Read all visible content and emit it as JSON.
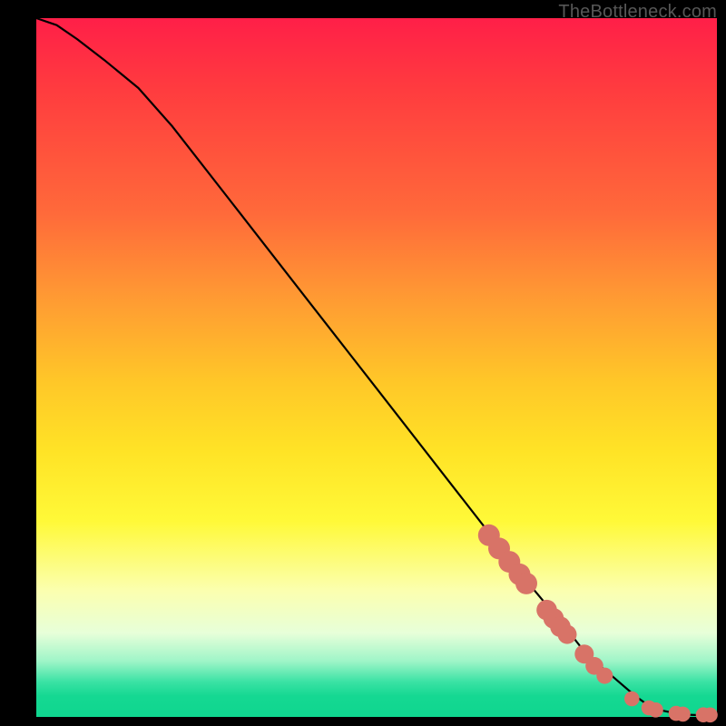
{
  "attribution": "TheBottleneck.com",
  "chart_data": {
    "type": "line",
    "title": "",
    "xlabel": "",
    "ylabel": "",
    "xlim": [
      0,
      100
    ],
    "ylim": [
      0,
      100
    ],
    "series": [
      {
        "name": "curve",
        "x": [
          0,
          3,
          6,
          10,
          15,
          20,
          30,
          40,
          50,
          60,
          68,
          72,
          75,
          78,
          80,
          82,
          85,
          88,
          90,
          92,
          94,
          96,
          98,
          100
        ],
        "y": [
          100,
          99,
          97,
          94,
          90,
          84.5,
          72,
          59.5,
          47,
          34.5,
          24.5,
          19.5,
          16,
          12.5,
          10,
          8,
          5.5,
          3,
          1.6,
          0.9,
          0.5,
          0.3,
          0.25,
          0.25
        ]
      }
    ],
    "markers": [
      {
        "x": 66.5,
        "y": 26.0,
        "r": 1.6
      },
      {
        "x": 68.0,
        "y": 24.1,
        "r": 1.6
      },
      {
        "x": 69.5,
        "y": 22.2,
        "r": 1.6
      },
      {
        "x": 71.0,
        "y": 20.4,
        "r": 1.6
      },
      {
        "x": 72.0,
        "y": 19.1,
        "r": 1.6
      },
      {
        "x": 75.0,
        "y": 15.3,
        "r": 1.5
      },
      {
        "x": 76.0,
        "y": 14.1,
        "r": 1.5
      },
      {
        "x": 77.0,
        "y": 12.9,
        "r": 1.5
      },
      {
        "x": 78.0,
        "y": 11.8,
        "r": 1.4
      },
      {
        "x": 80.5,
        "y": 9.0,
        "r": 1.4
      },
      {
        "x": 82.0,
        "y": 7.3,
        "r": 1.3
      },
      {
        "x": 83.5,
        "y": 5.9,
        "r": 1.2
      },
      {
        "x": 87.5,
        "y": 2.6,
        "r": 1.1
      },
      {
        "x": 90.0,
        "y": 1.3,
        "r": 1.1
      },
      {
        "x": 91.0,
        "y": 1.0,
        "r": 1.1
      },
      {
        "x": 94.0,
        "y": 0.5,
        "r": 1.1
      },
      {
        "x": 95.0,
        "y": 0.4,
        "r": 1.1
      },
      {
        "x": 98.0,
        "y": 0.3,
        "r": 1.1
      },
      {
        "x": 99.0,
        "y": 0.28,
        "r": 1.1
      }
    ],
    "gradient_stops": [
      {
        "pos": 0,
        "color": "#ff1f48"
      },
      {
        "pos": 10,
        "color": "#ff3b3f"
      },
      {
        "pos": 28,
        "color": "#ff6a3a"
      },
      {
        "pos": 40,
        "color": "#ff9a33"
      },
      {
        "pos": 52,
        "color": "#ffc728"
      },
      {
        "pos": 62,
        "color": "#ffe326"
      },
      {
        "pos": 72,
        "color": "#fff938"
      },
      {
        "pos": 82,
        "color": "#fbffb0"
      },
      {
        "pos": 88,
        "color": "#e7ffd9"
      },
      {
        "pos": 92,
        "color": "#9ff5c8"
      },
      {
        "pos": 95,
        "color": "#3ae2a4"
      },
      {
        "pos": 97,
        "color": "#15d892"
      },
      {
        "pos": 100,
        "color": "#0fd68f"
      }
    ]
  }
}
